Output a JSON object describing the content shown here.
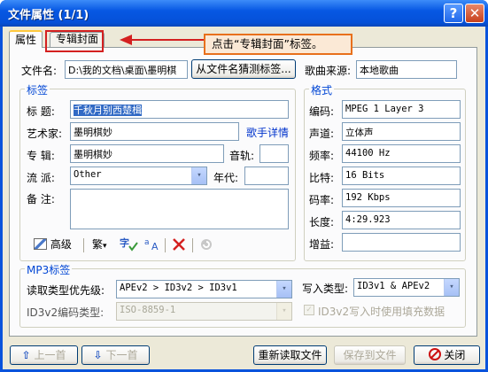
{
  "window": {
    "title": "文件属性 (1/1)",
    "help_glyph": "?",
    "close_glyph": "✕"
  },
  "tabs": {
    "properties": "属性",
    "cover": "专辑封面"
  },
  "callout": "点击“专辑封面”标签。",
  "file": {
    "name_label": "文件名:",
    "name_value": "D:\\我的文档\\桌面\\墨明棋",
    "guess_button": "从文件名猜测标签...",
    "source_label": "歌曲来源:",
    "source_value": "本地歌曲"
  },
  "tag": {
    "group_title": "标签",
    "title_label": "标  题:",
    "title_value": "千秋月别西楚楫",
    "artist_label": "艺术家:",
    "artist_value": "墨明棋妙",
    "artist_link": "歌手详情",
    "album_label": "专  辑:",
    "album_value": "墨明棋妙",
    "track_label": "音轨:",
    "track_value": "",
    "genre_label": "流  派:",
    "genre_value": "Other",
    "year_label": "年代:",
    "year_value": "",
    "comment_label": "备  注:",
    "comment_value": ""
  },
  "toolbar": {
    "advanced_label": "高级",
    "traditional_label": "繁",
    "dropdown_glyph": "▾"
  },
  "format": {
    "group_title": "格式",
    "rows": [
      {
        "label": "编码:",
        "value": "MPEG 1 Layer 3"
      },
      {
        "label": "声道:",
        "value": "立体声"
      },
      {
        "label": "频率:",
        "value": "44100 Hz"
      },
      {
        "label": "比特:",
        "value": "16 Bits"
      },
      {
        "label": "码率:",
        "value": "192 Kbps"
      },
      {
        "label": "长度:",
        "value": "4:29.923"
      },
      {
        "label": "增益:",
        "value": ""
      }
    ]
  },
  "mp3": {
    "group_title": "MP3标签",
    "read_priority_label": "读取类型优先级:",
    "read_priority_value": "APEv2 > ID3v2 > ID3v1",
    "write_type_label": "写入类型:",
    "write_type_value": "ID3v1 & APEv2",
    "encoding_label": "ID3v2编码类型:",
    "encoding_value": "ISO-8859-1",
    "padding_label": "ID3v2写入时使用填充数据",
    "padding_checked": true
  },
  "footer": {
    "prev": "上一首",
    "next": "下一首",
    "reread": "重新读取文件",
    "save": "保存到文件",
    "close": "关闭"
  },
  "colors": {
    "titlebar": "#0758e3",
    "dialog": "#ece9d8",
    "callout_border": "#e8701c",
    "highlight": "#d42020",
    "link": "#0033cc"
  }
}
